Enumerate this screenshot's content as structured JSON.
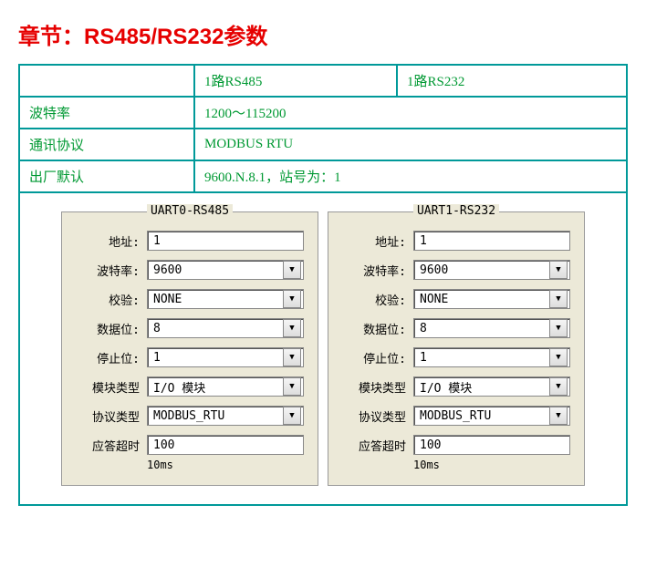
{
  "title": "章节：RS485/RS232参数",
  "spec": {
    "col1": "1路RS485",
    "col2": "1路RS232",
    "rows": [
      {
        "label": "波特率",
        "value": "1200～115200"
      },
      {
        "label": "通讯协议",
        "value": "MODBUS RTU"
      },
      {
        "label": "出厂默认",
        "value": "9600.N.8.1，站号为：1"
      }
    ]
  },
  "panels": [
    {
      "legend": "UART0-RS485",
      "fields": {
        "addr": {
          "label": "地址:",
          "value": "1",
          "type": "text"
        },
        "baud": {
          "label": "波特率:",
          "value": "9600",
          "type": "select"
        },
        "parity": {
          "label": "校验:",
          "value": "NONE",
          "type": "select"
        },
        "databits": {
          "label": "数据位:",
          "value": "8",
          "type": "select"
        },
        "stopbits": {
          "label": "停止位:",
          "value": "1",
          "type": "select"
        },
        "modtype": {
          "label": "模块类型",
          "value": "I/O 模块",
          "type": "select"
        },
        "prottype": {
          "label": "协议类型",
          "value": "MODBUS_RTU",
          "type": "select"
        },
        "timeout": {
          "label": "应答超时",
          "value": "100",
          "type": "text",
          "unit": "10ms"
        }
      }
    },
    {
      "legend": "UART1-RS232",
      "fields": {
        "addr": {
          "label": "地址:",
          "value": "1",
          "type": "text"
        },
        "baud": {
          "label": "波特率:",
          "value": "9600",
          "type": "select"
        },
        "parity": {
          "label": "校验:",
          "value": "NONE",
          "type": "select"
        },
        "databits": {
          "label": "数据位:",
          "value": "8",
          "type": "select"
        },
        "stopbits": {
          "label": "停止位:",
          "value": "1",
          "type": "select"
        },
        "modtype": {
          "label": "模块类型",
          "value": "I/O 模块",
          "type": "select"
        },
        "prottype": {
          "label": "协议类型",
          "value": "MODBUS_RTU",
          "type": "select"
        },
        "timeout": {
          "label": "应答超时",
          "value": "100",
          "type": "text",
          "unit": "10ms"
        }
      }
    }
  ]
}
